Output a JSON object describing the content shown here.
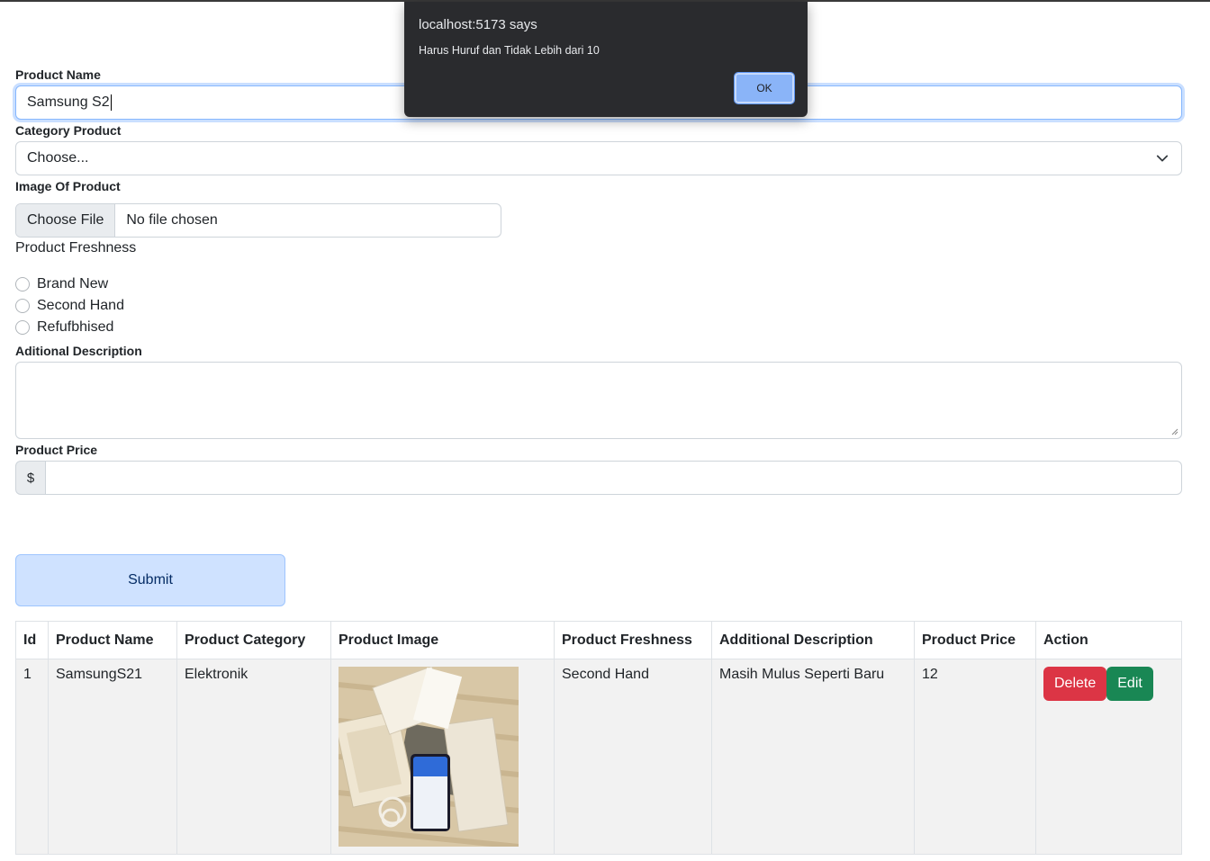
{
  "form": {
    "product_name_label": "Product Name",
    "product_name_value": "Samsung S2",
    "category_label": "Category Product",
    "category_selected": "Choose...",
    "image_label": "Image Of Product",
    "file_button": "Choose File",
    "file_status": "No file chosen",
    "freshness_label": "Product Freshness",
    "freshness_options": [
      "Brand New",
      "Second Hand",
      "Refufbhised"
    ],
    "description_label": "Aditional Description",
    "description_value": "",
    "price_label": "Product Price",
    "price_prefix": "$",
    "price_value": "",
    "submit_label": "Submit"
  },
  "table": {
    "headers": [
      "Id",
      "Product Name",
      "Product Category",
      "Product Image",
      "Product Freshness",
      "Additional Description",
      "Product Price",
      "Action"
    ],
    "rows": [
      {
        "id": "1",
        "name": "SamsungS21",
        "category": "Elektronik",
        "freshness": "Second Hand",
        "description": "Masih Mulus Seperti Baru",
        "price": "12",
        "delete_label": "Delete",
        "edit_label": "Edit"
      }
    ]
  },
  "dialog": {
    "title": "localhost:5173 says",
    "message": "Harus Huruf dan Tidak Lebih dari 10",
    "ok_label": "OK"
  },
  "colors": {
    "delete": "#dc3545",
    "edit": "#198754",
    "submit_bg": "#cfe2ff",
    "dialog_bg": "#2a2b2e",
    "dialog_ok": "#8ab4f8"
  }
}
